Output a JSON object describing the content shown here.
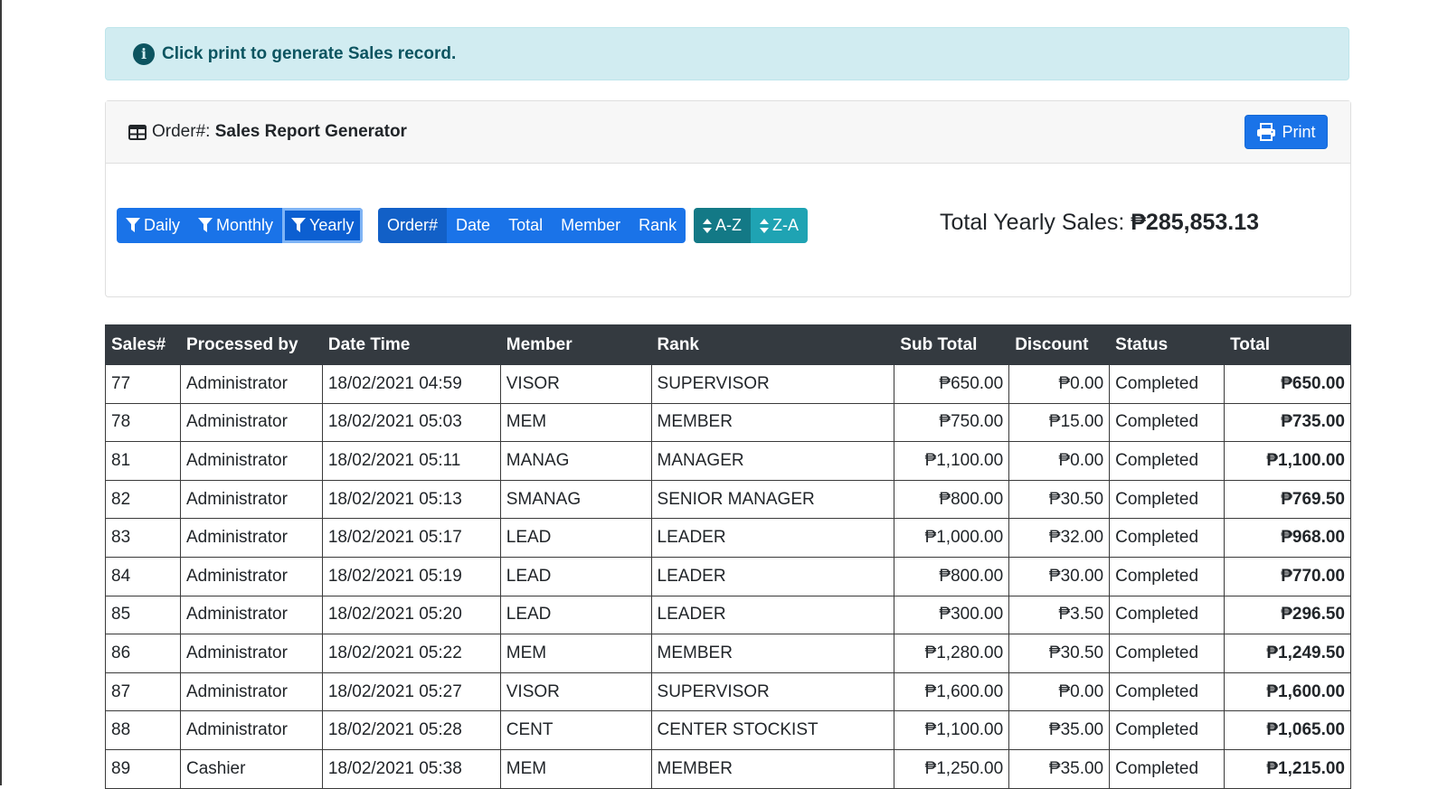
{
  "alert": {
    "icon": "info-circle-icon",
    "text": "Click print to generate Sales record."
  },
  "card": {
    "title_prefix": "Order#:",
    "title": "Sales Report Generator",
    "title_icon": "table-icon",
    "print_label": "Print",
    "print_icon": "printer-icon"
  },
  "filters": {
    "daily": "Daily",
    "monthly": "Monthly",
    "yearly": "Yearly",
    "active": "Yearly",
    "icon": "filter-icon"
  },
  "sort_fields": {
    "order": "Order#",
    "date": "Date",
    "total": "Total",
    "member": "Member",
    "rank": "Rank",
    "active": "Order#"
  },
  "sort_order": {
    "asc": "A-Z",
    "desc": "Z-A",
    "active": "A-Z",
    "icon": "sort-icon"
  },
  "summary": {
    "label": "Total Yearly Sales:",
    "value": "₱285,853.13"
  },
  "table": {
    "headers": [
      "Sales#",
      "Processed by",
      "Date Time",
      "Member",
      "Rank",
      "Sub Total",
      "Discount",
      "Status",
      "Total"
    ],
    "rows": [
      [
        "77",
        "Administrator",
        "18/02/2021 04:59",
        "VISOR",
        "SUPERVISOR",
        "₱650.00",
        "₱0.00",
        "Completed",
        "₱650.00"
      ],
      [
        "78",
        "Administrator",
        "18/02/2021 05:03",
        "MEM",
        "MEMBER",
        "₱750.00",
        "₱15.00",
        "Completed",
        "₱735.00"
      ],
      [
        "81",
        "Administrator",
        "18/02/2021 05:11",
        "MANAG",
        "MANAGER",
        "₱1,100.00",
        "₱0.00",
        "Completed",
        "₱1,100.00"
      ],
      [
        "82",
        "Administrator",
        "18/02/2021 05:13",
        "SMANAG",
        "SENIOR MANAGER",
        "₱800.00",
        "₱30.50",
        "Completed",
        "₱769.50"
      ],
      [
        "83",
        "Administrator",
        "18/02/2021 05:17",
        "LEAD",
        "LEADER",
        "₱1,000.00",
        "₱32.00",
        "Completed",
        "₱968.00"
      ],
      [
        "84",
        "Administrator",
        "18/02/2021 05:19",
        "LEAD",
        "LEADER",
        "₱800.00",
        "₱30.00",
        "Completed",
        "₱770.00"
      ],
      [
        "85",
        "Administrator",
        "18/02/2021 05:20",
        "LEAD",
        "LEADER",
        "₱300.00",
        "₱3.50",
        "Completed",
        "₱296.50"
      ],
      [
        "86",
        "Administrator",
        "18/02/2021 05:22",
        "MEM",
        "MEMBER",
        "₱1,280.00",
        "₱30.50",
        "Completed",
        "₱1,249.50"
      ],
      [
        "87",
        "Administrator",
        "18/02/2021 05:27",
        "VISOR",
        "SUPERVISOR",
        "₱1,600.00",
        "₱0.00",
        "Completed",
        "₱1,600.00"
      ],
      [
        "88",
        "Administrator",
        "18/02/2021 05:28",
        "CENT",
        "CENTER STOCKIST",
        "₱1,100.00",
        "₱35.00",
        "Completed",
        "₱1,065.00"
      ],
      [
        "89",
        "Cashier",
        "18/02/2021 05:38",
        "MEM",
        "MEMBER",
        "₱1,250.00",
        "₱35.00",
        "Completed",
        "₱1,215.00"
      ]
    ]
  },
  "colors": {
    "alert_bg": "#d1ecf1",
    "alert_text": "#0c5460",
    "primary": "#1a73e8",
    "teal": "#1fa3b3",
    "dark_header": "#343a40"
  }
}
